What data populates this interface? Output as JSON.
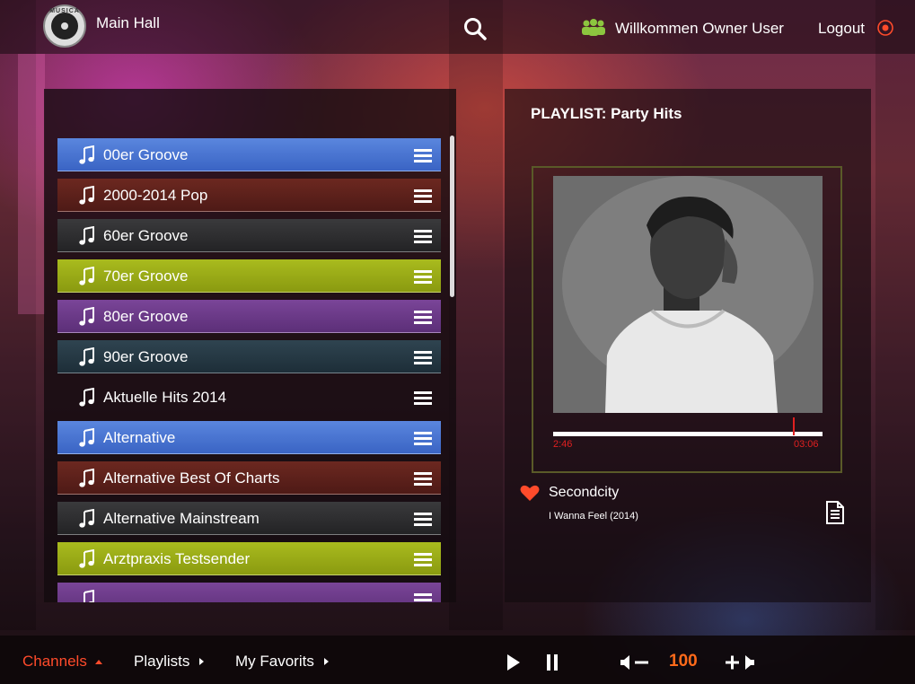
{
  "header": {
    "logo_text": "MUSICA",
    "venue": "Main Hall",
    "welcome": "Willkommen Owner User",
    "logout": "Logout"
  },
  "channels": [
    {
      "label": "00er Groove",
      "color": "blue"
    },
    {
      "label": "2000-2014 Pop",
      "color": "maroon"
    },
    {
      "label": "60er Groove",
      "color": "dark"
    },
    {
      "label": "70er Groove",
      "color": "lime"
    },
    {
      "label": "80er Groove",
      "color": "purple"
    },
    {
      "label": "90er Groove",
      "color": "teal"
    },
    {
      "label": "Aktuelle Hits 2014",
      "color": "none"
    },
    {
      "label": "Alternative",
      "color": "blue"
    },
    {
      "label": "Alternative Best Of Charts",
      "color": "maroon"
    },
    {
      "label": "Alternative Mainstream",
      "color": "dark"
    },
    {
      "label": "Arztpraxis Testsender",
      "color": "lime"
    },
    {
      "label": "",
      "color": "purple"
    }
  ],
  "player": {
    "playlist_title": "PLAYLIST: Party Hits",
    "time_current": "2:46",
    "time_total": "03:06",
    "progress": 0.89,
    "artist": "Secondcity",
    "track": "I Wanna Feel (2014)"
  },
  "bottom": {
    "channels": "Channels",
    "playlists": "Playlists",
    "favorites": "My Favorits",
    "volume": "100"
  },
  "colors": {
    "accent": "#ff4b2b",
    "volume": "#ff6a1a",
    "users_icon": "#8cc63f",
    "progress_marker": "#e02020"
  },
  "icons": [
    "search-icon",
    "users-icon",
    "logout-icon",
    "music-note-icon",
    "menu-icon",
    "heart-icon",
    "document-icon",
    "play-icon",
    "pause-icon",
    "volume-down-icon",
    "volume-up-icon",
    "chevron-up-icon",
    "chevron-right-icon"
  ]
}
